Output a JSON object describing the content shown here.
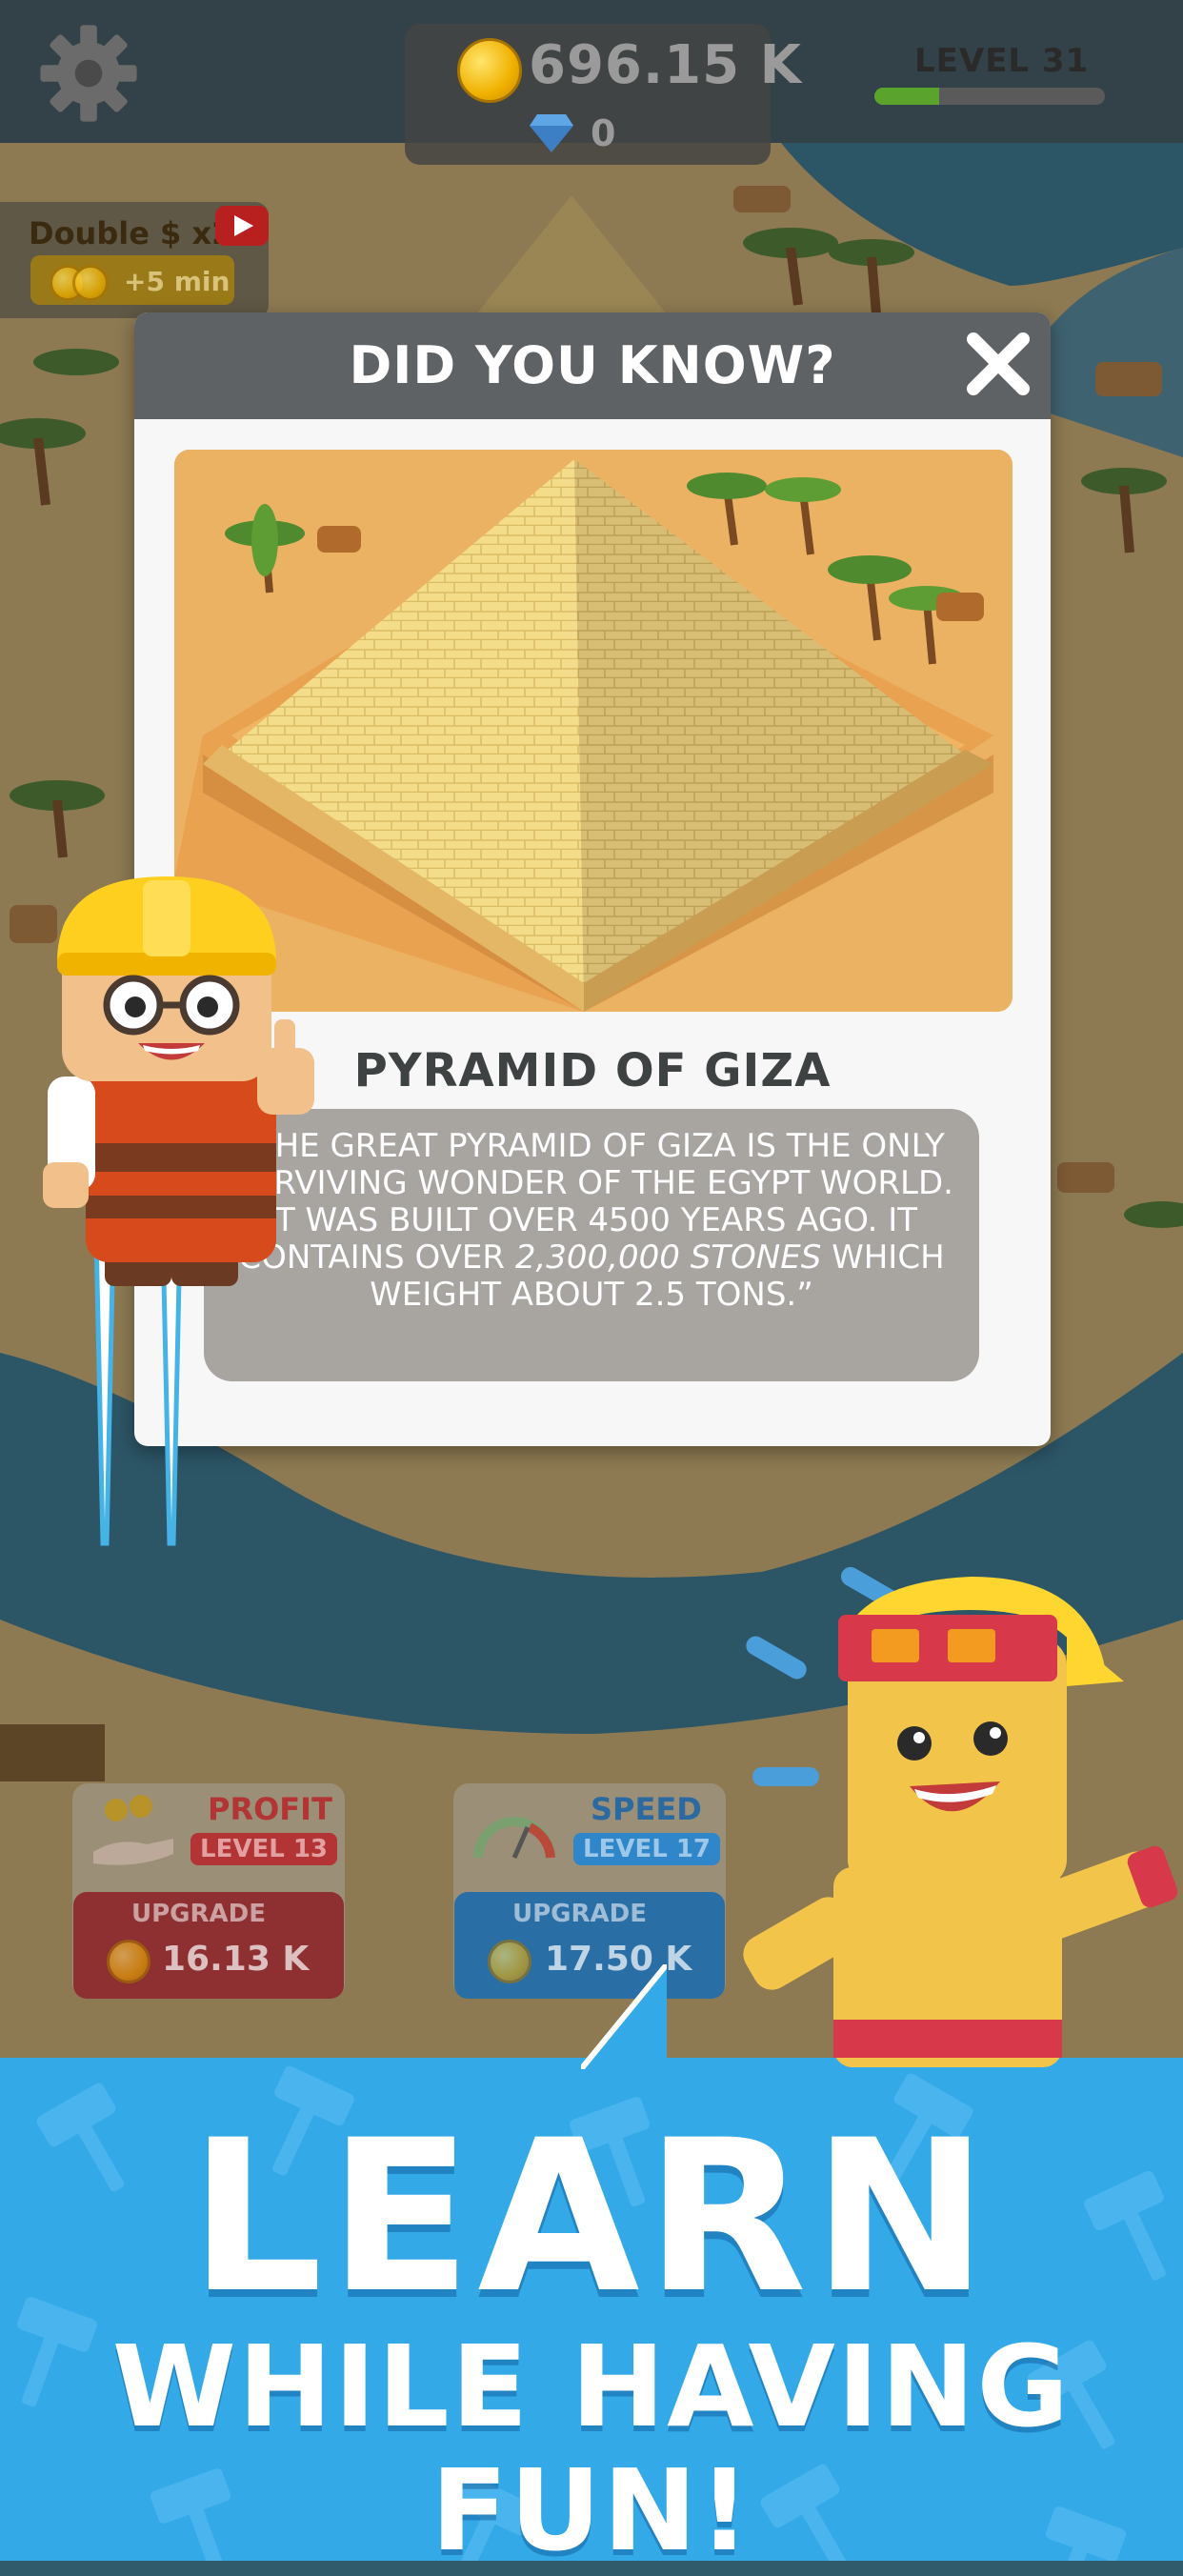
{
  "hud": {
    "coins": "696.15 K",
    "gems": "0",
    "level_label": "LEVEL 31",
    "level_progress": 0.28
  },
  "boost": {
    "label": "Double $ x2",
    "time_bonus": "+5 min"
  },
  "popup": {
    "title": "DID YOU KNOW?",
    "wonder_name": "PYRAMID OF GIZA",
    "fact_part1": "“THE GREAT PYRAMID OF GIZA IS THE ONLY SURVIVING WONDER OF THE EGYPT WORLD. IT WAS BUILT OVER 4500 YEARS AGO. IT CONTAINS OVER",
    "fact_emphasis": "2,300,000 STONES",
    "fact_part2": "WHICH WEIGHT ABOUT 2.5 TONS.”"
  },
  "upgrades": [
    {
      "title": "PROFIT",
      "level": "LEVEL 13",
      "button": "UPGRADE",
      "cost": "16.13 K",
      "color": "#d23a3a"
    },
    {
      "title": "SPEED",
      "level": "LEVEL 17",
      "button": "UPGRADE",
      "cost": "17.50 K",
      "color": "#2f86c9"
    }
  ],
  "banner": {
    "headline": "LEARN",
    "subline": "WHILE HAVING FUN!"
  },
  "colors": {
    "banner_bg": "#33a9e8",
    "modal_header": "#5f6264",
    "fact_box": "#a8a5a1",
    "level_fill": "#5aa32c"
  },
  "icons": [
    "gear-icon",
    "coin-icon",
    "gem-icon",
    "youtube-icon",
    "close-icon",
    "gauge-icon",
    "hand-coins-icon",
    "hammer-icon"
  ]
}
